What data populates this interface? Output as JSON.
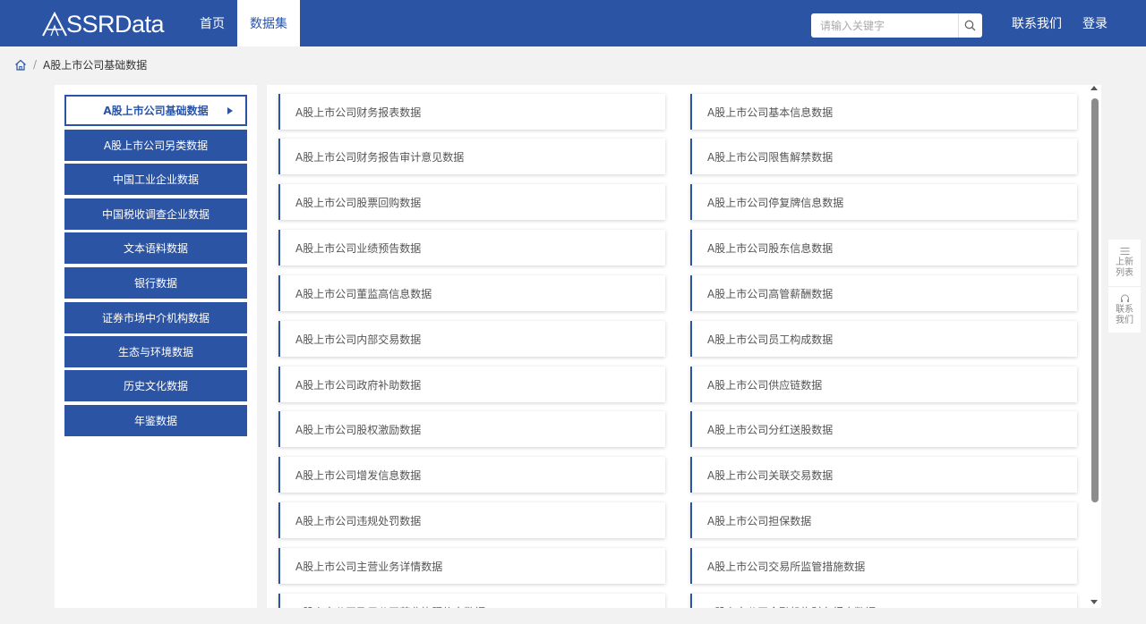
{
  "header": {
    "logo_text": "SSRData",
    "nav": [
      "首页",
      "数据集"
    ],
    "search_placeholder": "请输入关键字",
    "contact": "联系我们",
    "login": "登录"
  },
  "breadcrumb": {
    "current": "A股上市公司基础数据"
  },
  "sidebar": {
    "items": [
      "A股上市公司基础数据",
      "A股上市公司另类数据",
      "中国工业企业数据",
      "中国税收调查企业数据",
      "文本语料数据",
      "银行数据",
      "证券市场中介机构数据",
      "生态与环境数据",
      "历史文化数据",
      "年鉴数据"
    ]
  },
  "datasets": {
    "left": [
      "A股上市公司财务报表数据",
      "A股上市公司财务报告审计意见数据",
      "A股上市公司股票回购数据",
      "A股上市公司业绩预告数据",
      "A股上市公司董监高信息数据",
      "A股上市公司内部交易数据",
      "A股上市公司政府补助数据",
      "A股上市公司股权激励数据",
      "A股上市公司增发信息数据",
      "A股上市公司违规处罚数据",
      "A股上市公司主营业务详情数据",
      "A股上市公司及子公司营业执照信息数据"
    ],
    "right": [
      "A股上市公司基本信息数据",
      "A股上市公司限售解禁数据",
      "A股上市公司停复牌信息数据",
      "A股上市公司股东信息数据",
      "A股上市公司高管薪酬数据",
      "A股上市公司员工构成数据",
      "A股上市公司供应链数据",
      "A股上市公司分红送股数据",
      "A股上市公司关联交易数据",
      "A股上市公司担保数据",
      "A股上市公司交易所监管措施数据",
      "A股上市公司金融机构财务报表数据"
    ]
  },
  "float_toolbar": {
    "list": [
      "上新",
      "列表"
    ],
    "contact": [
      "联系",
      "我们"
    ]
  },
  "colors": {
    "brand": "#2c54a4",
    "background": "#f2f2f2"
  }
}
